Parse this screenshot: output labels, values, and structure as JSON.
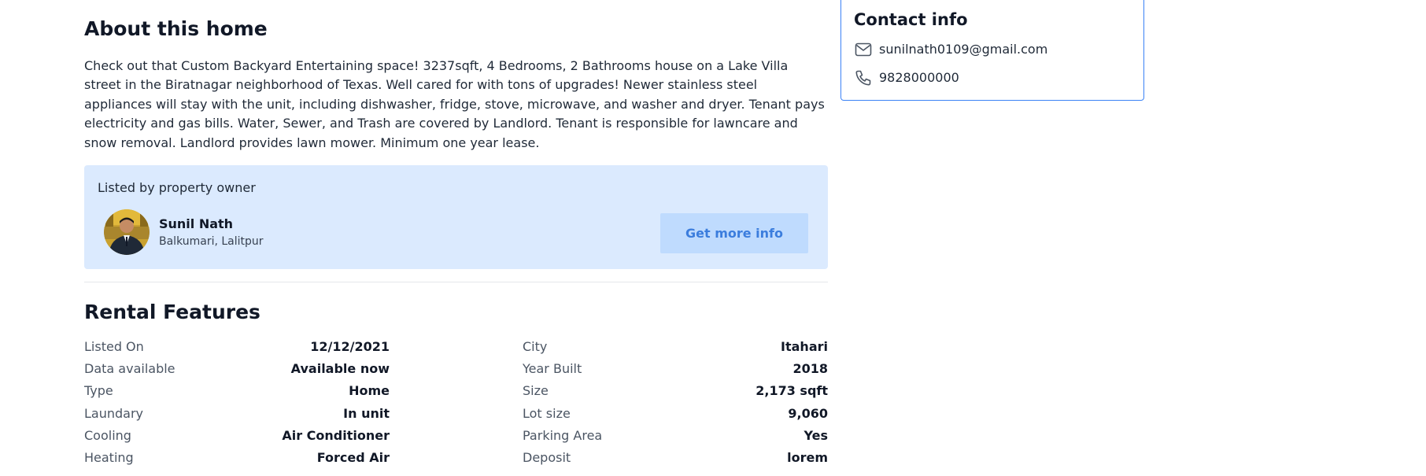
{
  "about": {
    "title": "About this home",
    "description": "Check out that Custom Backyard Entertaining space! 3237sqft, 4 Bedrooms, 2 Bathrooms house on a Lake Villa street in the Biratnagar neighborhood of Texas. Well cared for with tons of upgrades! Newer stainless steel appliances will stay with the unit, including dishwasher, fridge, stove, microwave, and washer and dryer. Tenant pays electricity and gas bills. Water, Sewer, and Trash are covered by Landlord. Tenant is responsible for lawncare and snow removal. Landlord provides lawn mower. Minimum one year lease."
  },
  "owner": {
    "heading": "Listed by property owner",
    "name": "Sunil Nath",
    "location": "Balkumari, Lalitpur",
    "button_label": "Get more info",
    "avatar_icon": "user-avatar-photo"
  },
  "features": {
    "title": "Rental Features",
    "left": [
      {
        "label": "Listed On",
        "value": "12/12/2021"
      },
      {
        "label": "Data available",
        "value": "Available now"
      },
      {
        "label": "Type",
        "value": "Home"
      },
      {
        "label": "Laundary",
        "value": "In unit"
      },
      {
        "label": "Cooling",
        "value": "Air Conditioner"
      },
      {
        "label": "Heating",
        "value": "Forced Air"
      }
    ],
    "right": [
      {
        "label": "City",
        "value": "Itahari"
      },
      {
        "label": "Year Built",
        "value": "2018"
      },
      {
        "label": "Size",
        "value": "2,173 sqft"
      },
      {
        "label": "Lot size",
        "value": "9,060"
      },
      {
        "label": "Parking Area",
        "value": "Yes"
      },
      {
        "label": "Deposit",
        "value": "lorem"
      }
    ]
  },
  "contact": {
    "title": "Contact info",
    "email": "sunilnath0109@gmail.com",
    "phone": "9828000000",
    "email_icon": "mail-icon",
    "phone_icon": "phone-icon"
  },
  "colors": {
    "accent": "#3b82f6",
    "owner_box_bg": "#dbeafe",
    "button_bg": "#bfdbfe",
    "button_text": "#3b7ddd"
  }
}
